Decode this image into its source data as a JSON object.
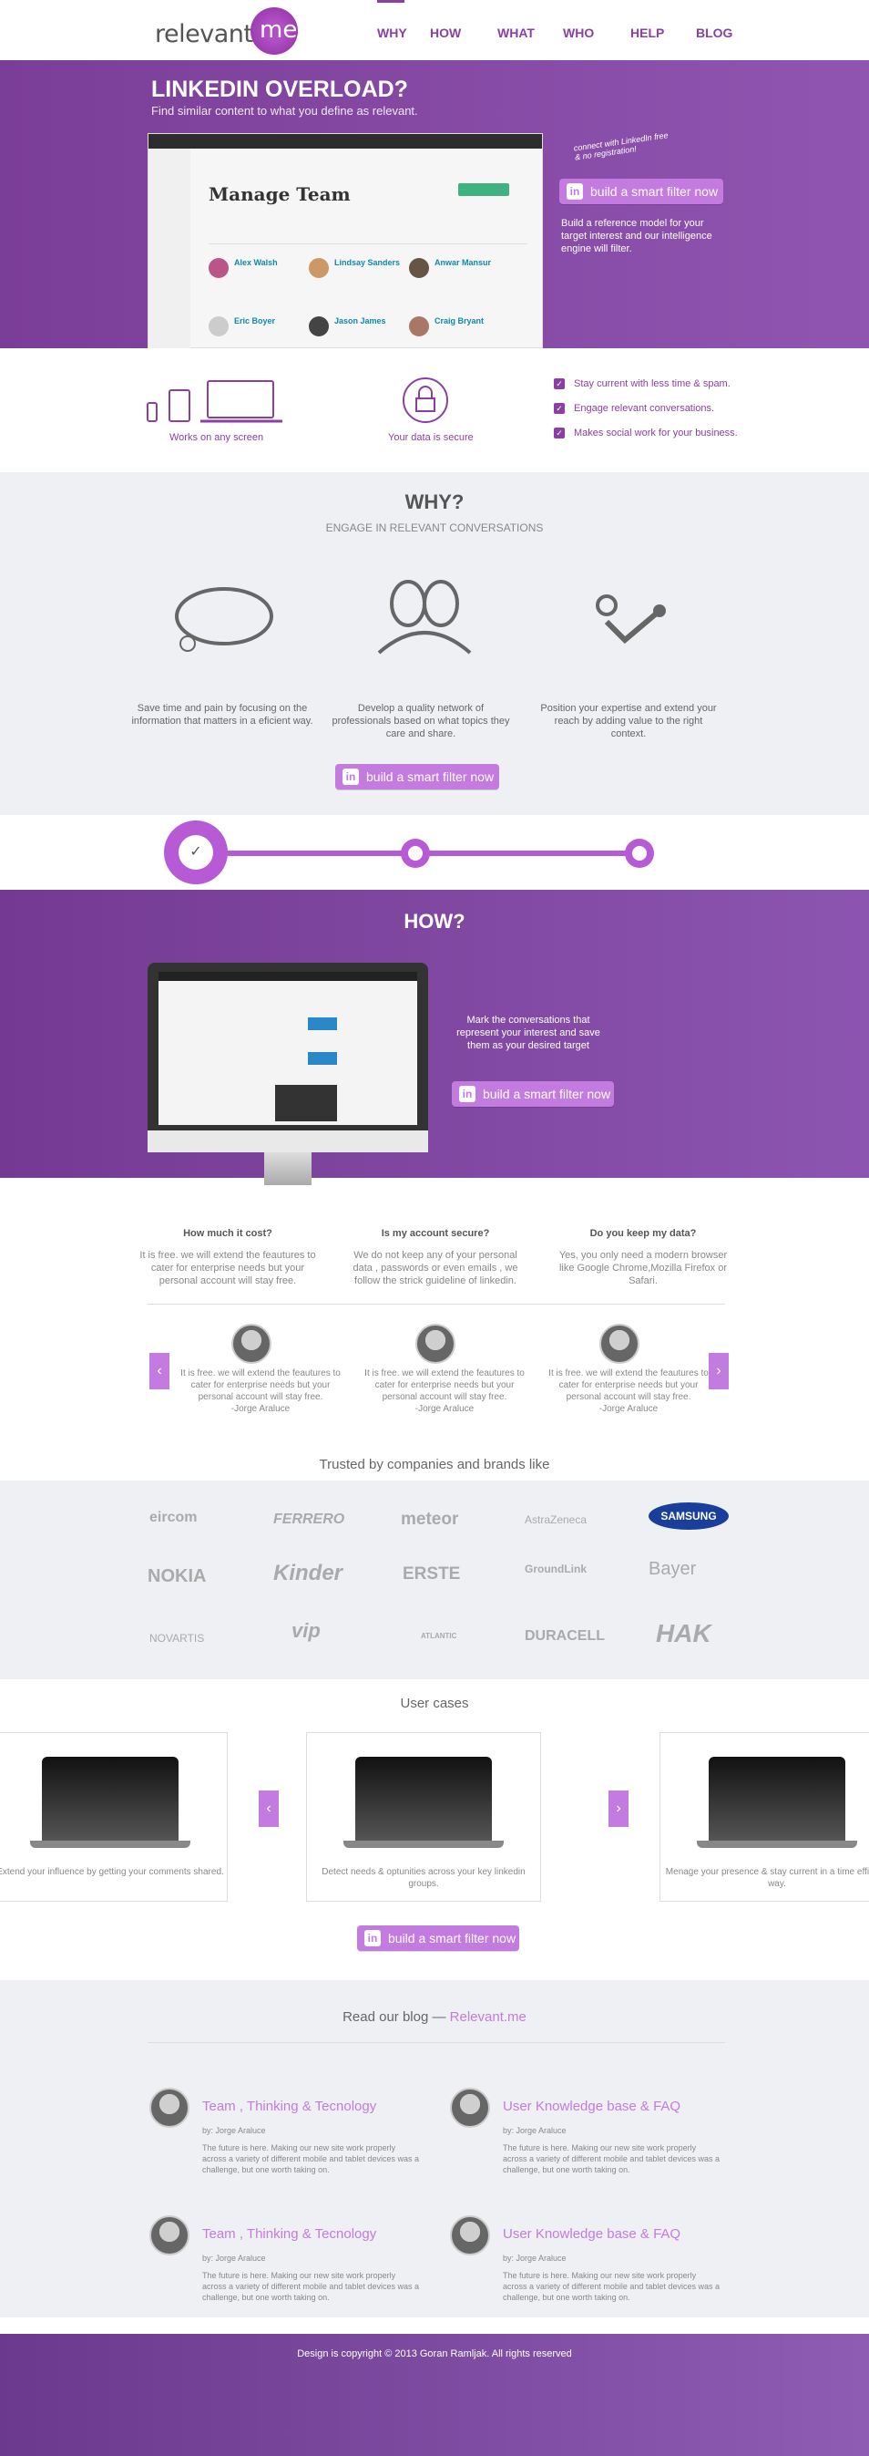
{
  "nav": {
    "logo": "relevante.",
    "logo_me": "me",
    "items": [
      "WHY",
      "HOW",
      "WHAT",
      "WHO",
      "HELP",
      "BLOG"
    ]
  },
  "hero": {
    "title": "LINKEDIN OVERLOAD?",
    "subtitle": "Find similar content to what you define as relevant.",
    "cta": "build a smart filter now",
    "note": "connect with LinkedIn free & no registration!",
    "description": "Build a reference model for your target interest and our intelligence engine will filter."
  },
  "mock": {
    "title": "Manage Team",
    "people": [
      "Alex Walsh",
      "Lindsay Sanders",
      "Anwar Mansur",
      "Eric Boyer",
      "Jason James",
      "Craig Bryant"
    ]
  },
  "features": {
    "screens": "Works on any screen",
    "secure": "Your data is secure",
    "checks": [
      "Stay current with less time & spam.",
      "Engage relevant conversations.",
      "Makes social work for your business."
    ]
  },
  "why": {
    "title": "WHY?",
    "subtitle": "ENGAGE IN RELEVANT CONVERSATIONS",
    "col1": "Save time and pain by focusing on the information that matters in a eficient way.",
    "col2": "Develop a quality network of professionals based on what topics they care and share.",
    "col3": "Position your expertise and extend your reach by adding value to the right context.",
    "cta": "build a smart filter now"
  },
  "how": {
    "title": "HOW?",
    "text": "Mark the conversations that represent your interest and save them as your desired target",
    "cta": "build a smart filter now"
  },
  "faq": [
    {
      "q": "How much it cost?",
      "a": "It is free. we will extend the feautures to cater for enterprise needs but your personal account will stay free."
    },
    {
      "q": "Is my account secure?",
      "a": "We do not keep any of your personal data , passwords or even emails , we follow the strick guideline of linkedin."
    },
    {
      "q": "Do you keep my data?",
      "a": "Yes, you only need a modern browser like Google Chrome,Mozilla Firefox or Safari."
    }
  ],
  "testimonials": [
    {
      "quote": "It is free. we will extend the feautures to cater for enterprise needs but your personal account will stay free.",
      "author": "-Jorge Araluce"
    },
    {
      "quote": "It is free. we will extend the feautures to cater for enterprise needs but your personal account will stay free.",
      "author": "-Jorge Araluce"
    },
    {
      "quote": "It is free. we will extend the feautures to cater for enterprise needs but your personal account will stay free.",
      "author": "-Jorge Araluce"
    }
  ],
  "trusted": {
    "title": "Trusted by companies and brands like",
    "brands": [
      "eircom",
      "FERRERO",
      "meteor",
      "AstraZeneca",
      "SAMSUNG",
      "NOKIA",
      "Kinder",
      "ERSTE",
      "GroundLink",
      "Bayer",
      "NOVARTIS",
      "vip",
      "ATLANTIC",
      "DURACELL",
      "HAK"
    ]
  },
  "cases": {
    "title": "User cases",
    "items": [
      "Extend your influence by getting your comments shared.",
      "Detect needs & optunities across your key linkedin groups.",
      "Menage your presence & stay current in a time efficient way."
    ],
    "cta": "build a smart filter now"
  },
  "blog": {
    "title": "Read our blog — ",
    "link": "Relevant.me",
    "posts": [
      {
        "title": "Team , Thinking & Tecnology",
        "by": "by: Jorge Araluce",
        "body": "The future is here. Making our new site work properly across a variety of different mobile and tablet devices was a challenge, but one worth taking on."
      },
      {
        "title": "User Knowledge base & FAQ",
        "by": "by: Jorge Araluce",
        "body": "The future is here. Making our new site work properly across a variety of different mobile and tablet devices was a challenge, but one worth taking on."
      },
      {
        "title": "Team , Thinking & Tecnology",
        "by": "by: Jorge Araluce",
        "body": "The future is here. Making our new site work properly across a variety of different mobile and tablet devices was a challenge, but one worth taking on."
      },
      {
        "title": "User Knowledge base & FAQ",
        "by": "by: Jorge Araluce",
        "body": "The future is here. Making our new site work properly across a variety of different mobile and tablet devices was a challenge, but one worth taking on."
      }
    ]
  },
  "footer": {
    "copyright": "Design is copyright © 2013 Goran Ramljak. All rights reserved"
  }
}
